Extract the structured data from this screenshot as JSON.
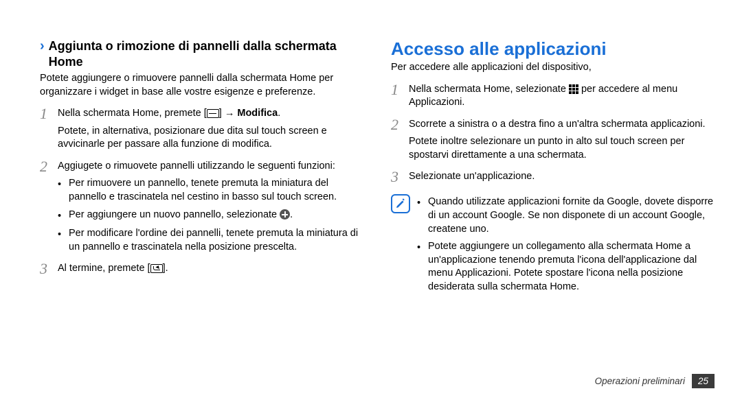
{
  "left": {
    "heading": "Aggiunta o rimozione di pannelli dalla schermata Home",
    "intro": "Potete aggiungere o rimuovere pannelli dalla schermata Home per organizzare i widget in base alle vostre esigenze e preferenze.",
    "step1_a": "Nella schermata Home, premete [",
    "step1_b": "] → ",
    "step1_bold": "Modifica",
    "step1_c": ".",
    "step1_p2": "Potete, in alternativa, posizionare due dita sul touch screen e avvicinarle per passare alla funzione di modifica.",
    "step2": "Aggiugete o rimuovete pannelli utilizzando le seguenti funzioni:",
    "bullet1": "Per rimuovere un pannello, tenete premuta la miniatura del pannello e trascinatela nel cestino in basso sul touch screen.",
    "bullet2_a": "Per aggiungere un nuovo pannello, selezionate ",
    "bullet2_b": ".",
    "bullet3": "Per modificare l'ordine dei pannelli, tenete premuta la miniatura di un pannello e trascinatela nella posizione prescelta.",
    "step3_a": "Al termine, premete [",
    "step3_b": "]."
  },
  "right": {
    "title": "Accesso alle applicazioni",
    "intro": "Per accedere alle applicazioni del dispositivo,",
    "step1_a": "Nella schermata Home, selezionate ",
    "step1_b": " per accedere al menu Applicazioni.",
    "step2": "Scorrete a sinistra o a destra fino a un'altra schermata applicazioni.",
    "step2_p2": "Potete inoltre selezionare un punto in alto sul touch screen per spostarvi direttamente a una schermata.",
    "step3": "Selezionate un'applicazione.",
    "note_b1": "Quando utilizzate applicazioni fornite da Google, dovete disporre di un account Google. Se non disponete di un account Google, createne uno.",
    "note_b2": "Potete aggiungere un collegamento alla schermata Home a un'applicazione tenendo premuta l'icona dell'applicazione dal menu Applicazioni. Potete spostare l'icona nella posizione desiderata sulla schermata Home."
  },
  "footer": {
    "label": "Operazioni preliminari",
    "page": "25"
  },
  "nums": {
    "n1": "1",
    "n2": "2",
    "n3": "3"
  }
}
